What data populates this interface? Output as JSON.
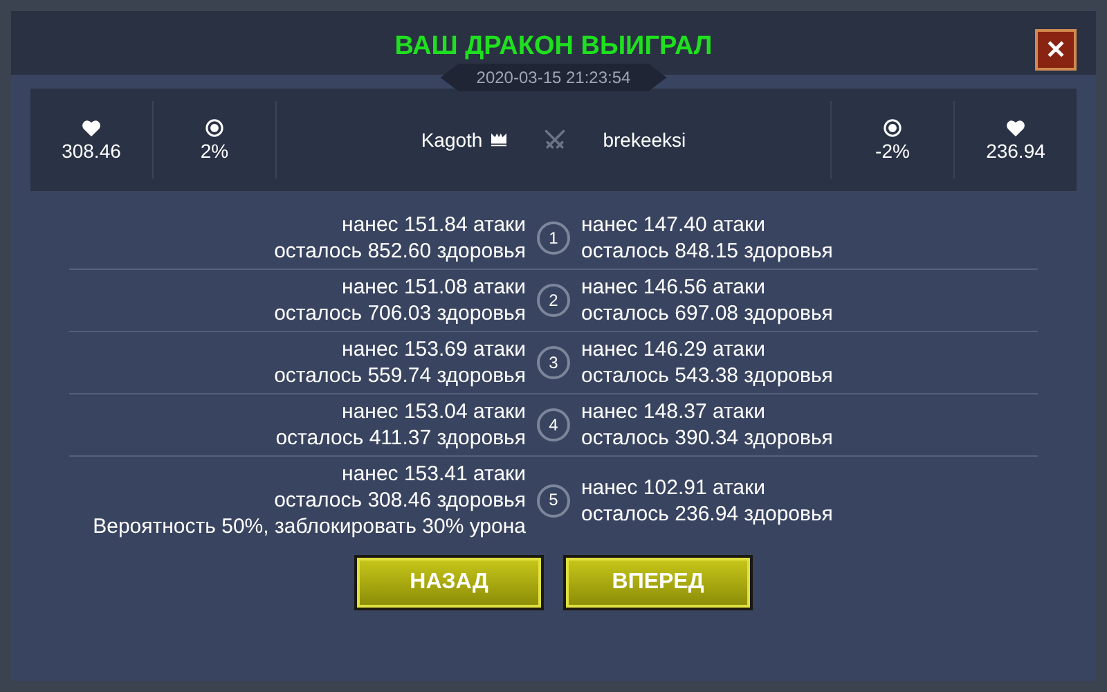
{
  "title": "ВАШ ДРАКОН ВЫИГРАЛ",
  "date": "2020-03-15 21:23:54",
  "close_label": "✕",
  "left": {
    "health": "308.46",
    "chance": "2%",
    "name": "Kagoth"
  },
  "right": {
    "health": "236.94",
    "chance": "-2%",
    "name": "brekeeksi"
  },
  "rounds": [
    {
      "number": "1",
      "left": [
        "нанес 151.84 атаки",
        "осталось 852.60 здоровья"
      ],
      "right": [
        "нанес 147.40 атаки",
        "осталось 848.15 здоровья"
      ]
    },
    {
      "number": "2",
      "left": [
        "нанес 151.08 атаки",
        "осталось 706.03 здоровья"
      ],
      "right": [
        "нанес 146.56 атаки",
        "осталось 697.08 здоровья"
      ]
    },
    {
      "number": "3",
      "left": [
        "нанес 153.69 атаки",
        "осталось 559.74 здоровья"
      ],
      "right": [
        "нанес 146.29 атаки",
        "осталось 543.38 здоровья"
      ]
    },
    {
      "number": "4",
      "left": [
        "нанес 153.04 атаки",
        "осталось 411.37 здоровья"
      ],
      "right": [
        "нанес 148.37 атаки",
        "осталось 390.34 здоровья"
      ]
    },
    {
      "number": "5",
      "left": [
        "нанес 153.41 атаки",
        "осталось 308.46 здоровья",
        "Вероятность 50%, заблокировать 30% урона"
      ],
      "right": [
        "нанес 102.91 атаки",
        "осталось 236.94 здоровья"
      ]
    }
  ],
  "buttons": [
    "НАЗАД",
    "ВПЕРЕД"
  ]
}
